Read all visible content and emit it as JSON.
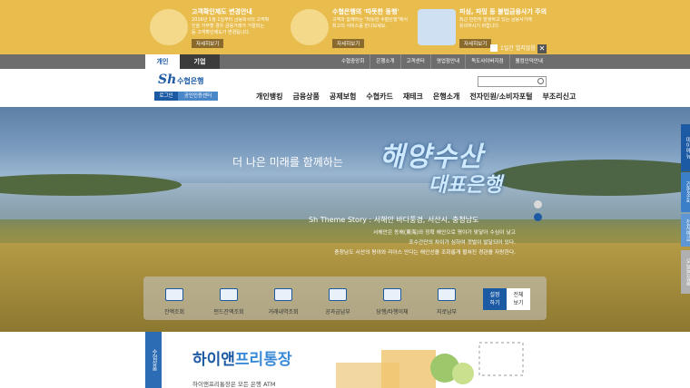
{
  "notices": [
    {
      "title": "고객확인제도 변경안내",
      "body": "2016년 1월 1일부터 금융회사의 고객확인을 거부할 경우 금융거래가 거절되는 등 고객확인제도가 변경됩니다.",
      "button": "자세히보기"
    },
    {
      "title": "수협은행의 '따뜻한 동행'",
      "body": "고객과 함께하는 \"따뜻한 수협은행\"에서 최고의 서비스를 만나보세요.",
      "button": "자세히보기"
    },
    {
      "title": "피싱, 파밍 등 불법금융사기 주의",
      "body": "최근 빈번히 발생하고 있는 금융사기에 유의하시기 바랍니다.",
      "button": "자세히보기"
    }
  ],
  "notice_close": {
    "checkbox_label": "1일간 열지않음",
    "close_symbol": "✕"
  },
  "segments": {
    "personal": "개인",
    "corporate": "기업"
  },
  "utility_links": [
    "수협중앙회",
    "은행소개",
    "고객센터",
    "영업점안내",
    "독도사이버지점",
    "웰컴인덕안내"
  ],
  "header": {
    "logo_mark": "Sh",
    "logo_name": "수협은행",
    "login": "로그인",
    "cert_center": "공인인증센터",
    "search_placeholder": ""
  },
  "nav": [
    "개인뱅킹",
    "금융상품",
    "공제보험",
    "수협카드",
    "재테크",
    "은행소개",
    "전자민원/소비자포털",
    "부조리신고"
  ],
  "hero": {
    "lead": "더 나은 미래를 함께하는",
    "calligraphy_1": "해양수산",
    "calligraphy_2": "대표은행",
    "theme_title": "Sh Theme Story : 서해안 바다풍경, 서산시, 충청남도",
    "description": [
      "서해안은 동해(東海)와 정확 해안으로 평야가 맞닿아 수심이 낮고",
      "조수간만의 차이가 심하여 갯벌이 발달되어 있다.",
      "충청남도 서산의 평야와 리아스 안다는 해안선을 조화롭게 펼쳐진 경관을 자랑한다."
    ]
  },
  "quick_menu": [
    {
      "label": "잔액조회",
      "icon": "won-icon"
    },
    {
      "label": "펀드잔액조회",
      "icon": "fund-chart-icon"
    },
    {
      "label": "거래내역조회",
      "icon": "magnifier-doc-icon"
    },
    {
      "label": "공과금납부",
      "icon": "upload-doc-icon"
    },
    {
      "label": "당행/타행이체",
      "icon": "transfer-icon"
    },
    {
      "label": "지로납부",
      "icon": "giro-icon"
    }
  ],
  "quick_actions": {
    "settings": [
      "설정",
      "하기"
    ],
    "view_all": [
      "전체",
      "보기"
    ]
  },
  "side_tabs": [
    "마이메뉴",
    "간편조회",
    "전자예금",
    "오늘본상품"
  ],
  "product": {
    "tab": "수협상품",
    "title_a": "하이앤",
    "title_b": "프리통장",
    "subtitle": "하이앤프리통장은 모든 은행 ATM"
  },
  "colors": {
    "brand_blue": "#1c5aa4",
    "notice_yellow": "#e9bd4d",
    "gnb_gray": "#6d6d6d"
  }
}
